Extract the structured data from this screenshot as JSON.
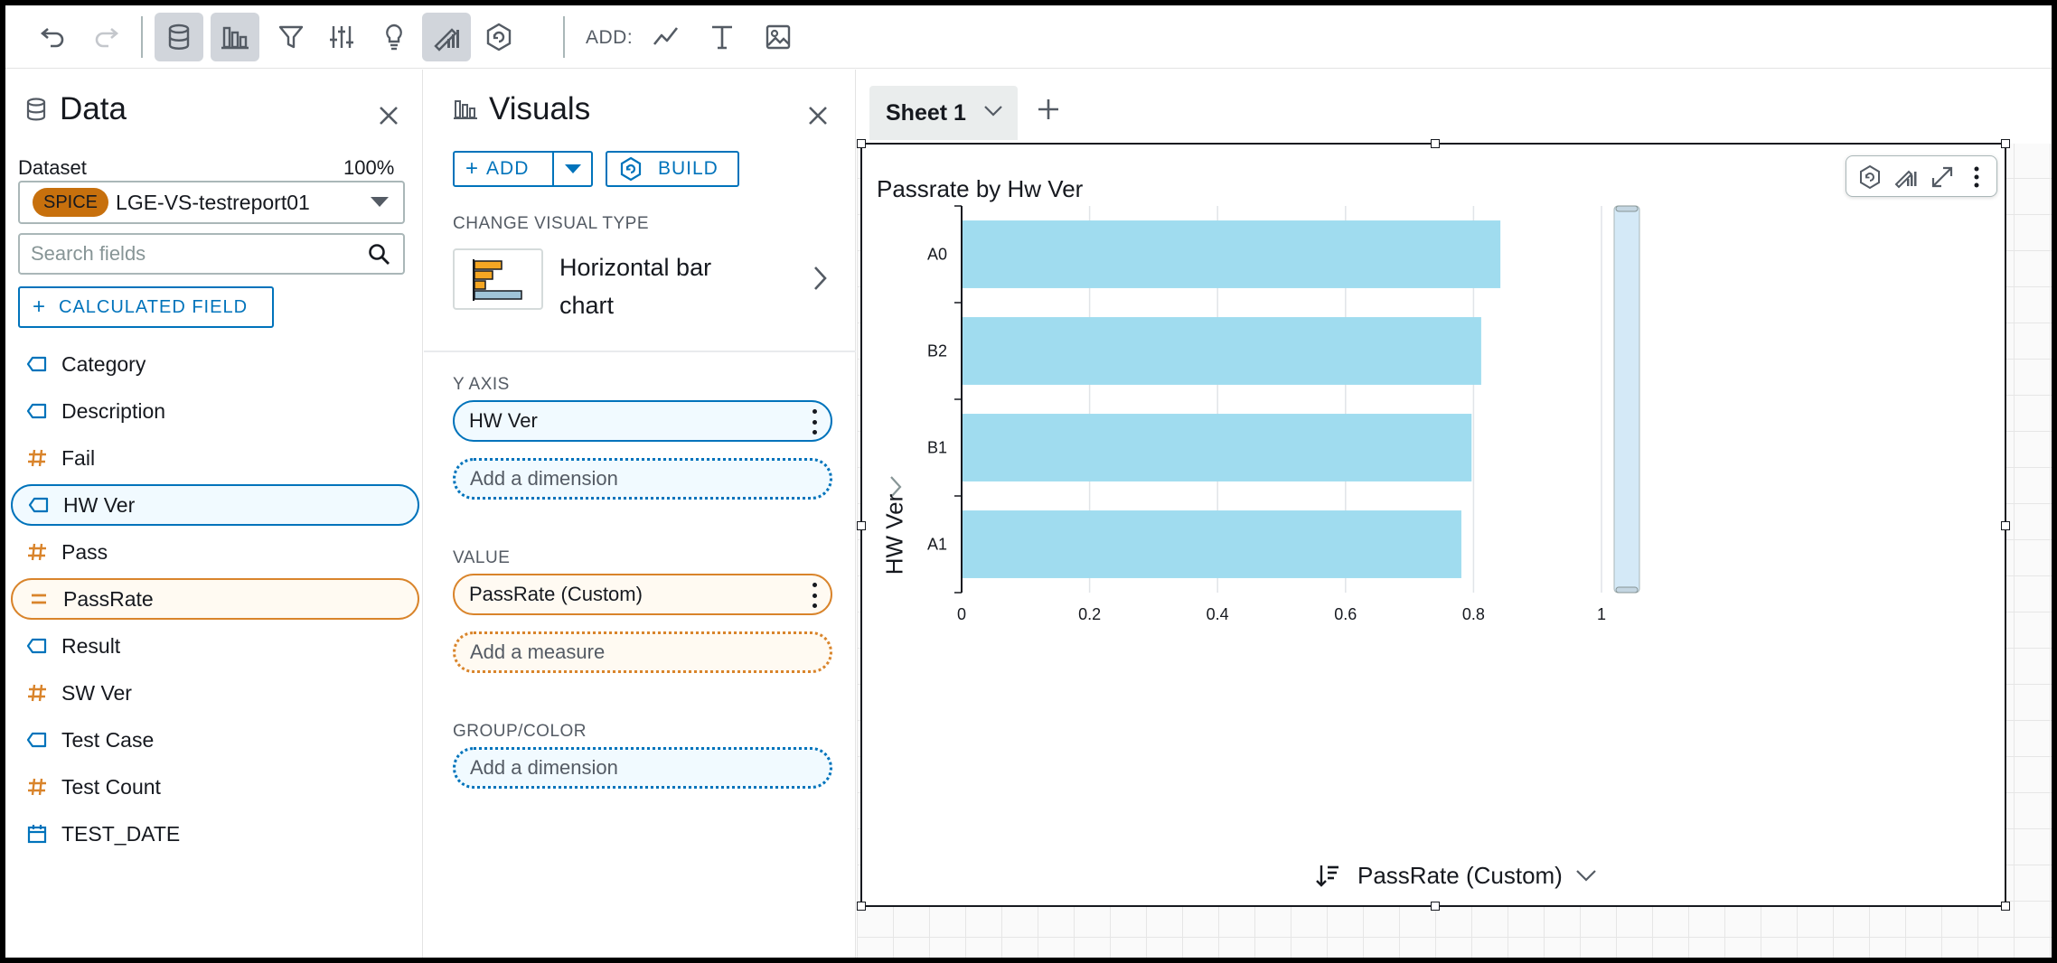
{
  "toolbar": {
    "add_label": "ADD:"
  },
  "data_panel": {
    "title": "Data",
    "dataset_label": "Dataset",
    "dataset_pct": "100%",
    "spice_badge": "SPICE",
    "dataset_name": "LGE-VS-testreport01",
    "search_placeholder": "Search fields",
    "calc_field_label": "CALCULATED FIELD",
    "fields": [
      {
        "label": "Category",
        "type": "dimension"
      },
      {
        "label": "Description",
        "type": "dimension"
      },
      {
        "label": "Fail",
        "type": "measure"
      },
      {
        "label": "HW Ver",
        "type": "dimension",
        "selected": true
      },
      {
        "label": "Pass",
        "type": "measure"
      },
      {
        "label": "PassRate",
        "type": "calculated",
        "selected": true
      },
      {
        "label": "Result",
        "type": "dimension"
      },
      {
        "label": "SW Ver",
        "type": "measure"
      },
      {
        "label": "Test Case",
        "type": "dimension"
      },
      {
        "label": "Test Count",
        "type": "measure"
      },
      {
        "label": "TEST_DATE",
        "type": "date"
      }
    ]
  },
  "visuals_panel": {
    "title": "Visuals",
    "add_label": "ADD",
    "build_label": "BUILD",
    "change_type_label": "CHANGE VISUAL TYPE",
    "visual_type_name": "Horizontal bar chart",
    "y_axis_label": "Y AXIS",
    "y_axis_field": "HW Ver",
    "y_axis_add": "Add a dimension",
    "value_label": "VALUE",
    "value_field": "PassRate (Custom)",
    "value_add": "Add a measure",
    "group_label": "GROUP/COLOR",
    "group_add": "Add a dimension"
  },
  "sheet": {
    "tab_label": "Sheet 1"
  },
  "visual": {
    "title": "Passrate by Hw Ver",
    "y_axis_title": "HW Ver",
    "x_axis_title": "PassRate (Custom)"
  },
  "colors": {
    "bar": "#a0dcef",
    "accent_blue": "#0073bb",
    "accent_orange": "#d9842b",
    "spice": "#c7700d"
  },
  "chart_data": {
    "type": "bar",
    "orientation": "horizontal",
    "categories": [
      "A0",
      "B2",
      "B1",
      "A1"
    ],
    "values": [
      0.842,
      0.812,
      0.797,
      0.781
    ],
    "xlim": [
      0,
      1
    ],
    "xticks": [
      "0",
      "0.2",
      "0.4",
      "0.6",
      "0.8",
      "1"
    ],
    "title": "Passrate by Hw Ver",
    "xlabel": "PassRate (Custom)",
    "ylabel": "HW Ver",
    "grid": "vertical"
  }
}
